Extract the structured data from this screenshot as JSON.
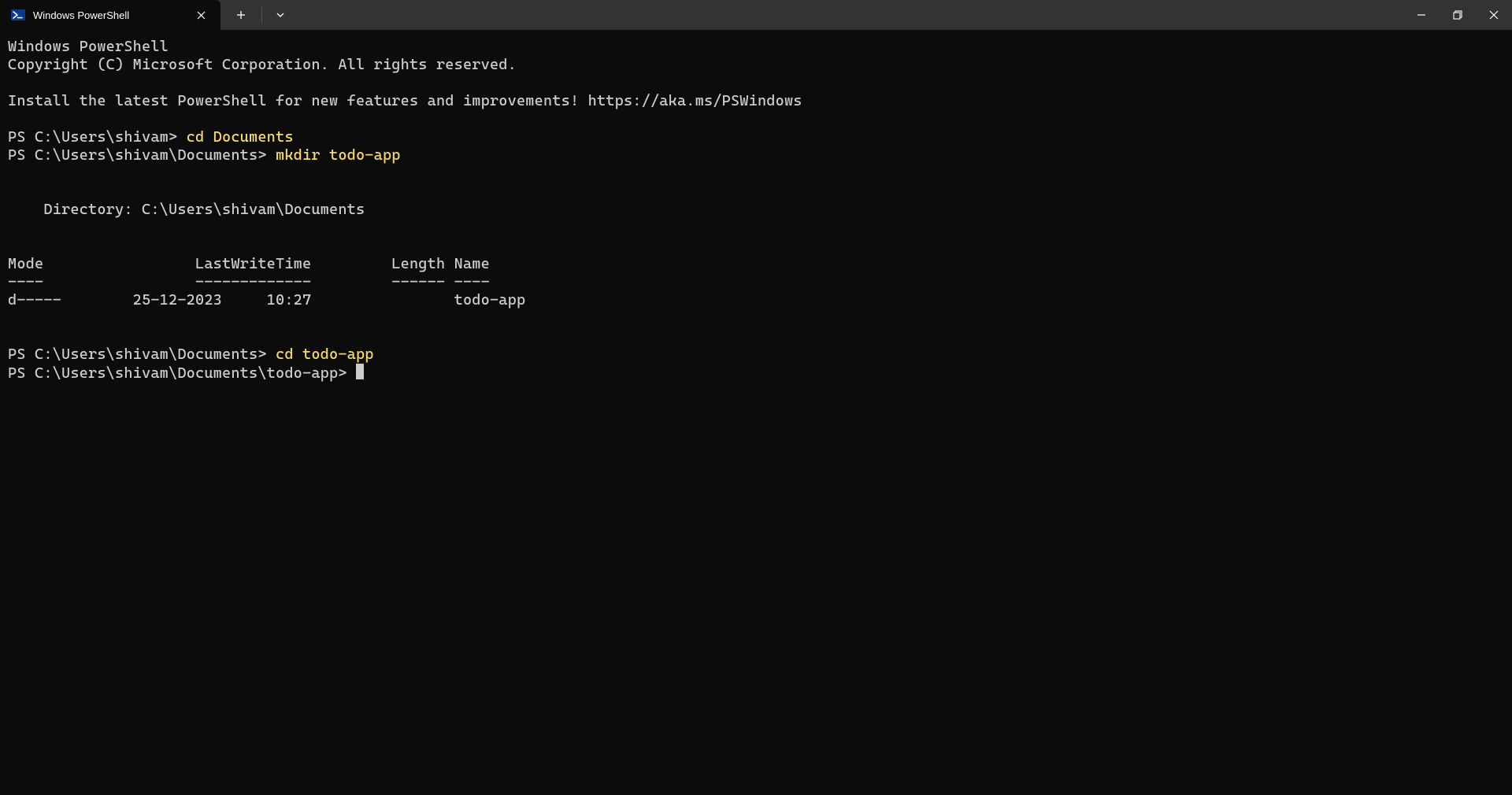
{
  "tab": {
    "title": "Windows PowerShell"
  },
  "banner": {
    "line1": "Windows PowerShell",
    "line2": "Copyright (C) Microsoft Corporation. All rights reserved.",
    "blank1": "",
    "line3": "Install the latest PowerShell for new features and improvements! https://aka.ms/PSWindows",
    "blank2": ""
  },
  "session": {
    "p1_prompt": "PS C:\\Users\\shivam> ",
    "p1_cmd": "cd Documents",
    "p2_prompt": "PS C:\\Users\\shivam\\Documents> ",
    "p2_cmd": "mkdir todo-app",
    "blank3": "",
    "blank4": "",
    "dir_header": "    Directory: C:\\Users\\shivam\\Documents",
    "blank5": "",
    "blank6": "",
    "table_head": "Mode                 LastWriteTime         Length Name",
    "table_rule": "----                 -------------         ------ ----",
    "table_row1": "d-----        25-12-2023     10:27                todo-app",
    "blank7": "",
    "blank8": "",
    "p3_prompt": "PS C:\\Users\\shivam\\Documents> ",
    "p3_cmd": "cd todo-app",
    "p4_prompt": "PS C:\\Users\\shivam\\Documents\\todo-app> "
  }
}
